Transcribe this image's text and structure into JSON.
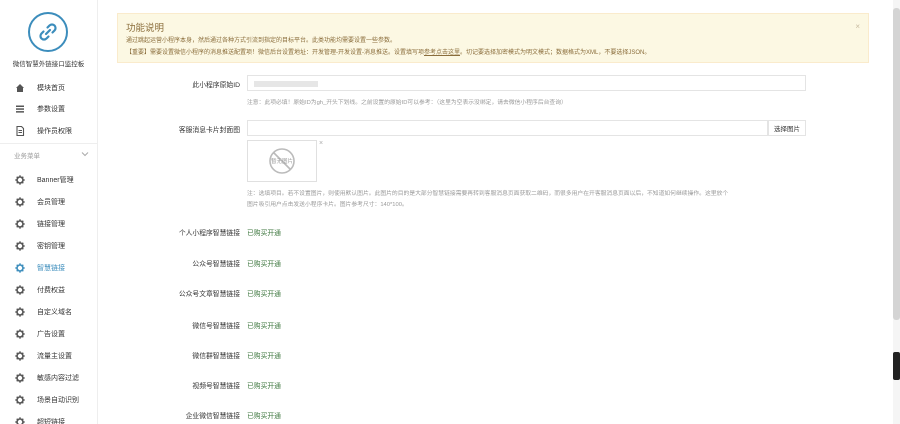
{
  "brand": {
    "name": "微信智慧外链接口监控板",
    "logo_icon": "link-icon",
    "accent": "#3c8dbc"
  },
  "sidebar": {
    "top_items": [
      {
        "label": "模块首页",
        "icon": "home-icon"
      },
      {
        "label": "参数设置",
        "icon": "list-icon"
      },
      {
        "label": "操作员权限",
        "icon": "file-icon"
      }
    ],
    "group_title": "业务菜单",
    "group_items": [
      {
        "label": "Banner管理",
        "icon": "gear-icon",
        "active": false
      },
      {
        "label": "会员管理",
        "icon": "gear-icon",
        "active": false
      },
      {
        "label": "链接管理",
        "icon": "gear-icon",
        "active": false
      },
      {
        "label": "密钥管理",
        "icon": "gear-icon",
        "active": false
      },
      {
        "label": "智慧链接",
        "icon": "gear-icon",
        "active": true
      },
      {
        "label": "付费权益",
        "icon": "gear-icon",
        "active": false
      },
      {
        "label": "自定义域名",
        "icon": "gear-icon",
        "active": false
      },
      {
        "label": "广告设置",
        "icon": "gear-icon",
        "active": false
      },
      {
        "label": "流量主设置",
        "icon": "gear-icon",
        "active": false
      },
      {
        "label": "敏感内容过滤",
        "icon": "gear-icon",
        "active": false
      },
      {
        "label": "场景自动识别",
        "icon": "gear-icon",
        "active": false
      },
      {
        "label": "超短链接",
        "icon": "gear-icon",
        "active": false
      }
    ]
  },
  "notice": {
    "title": "功能说明",
    "line1": "通过跳起运营小程序本身，然后通过各种方式引流到指定的目标平台。此类功能均需要设置一些参数。",
    "line2_prefix": "【重要】需要设置微信小程序的消息推送配置项！微信后台设置地址：开发管理-开发设置-消息推送。设置填写项",
    "line2_link": "参考点击这里",
    "line2_suffix": "。切记要选择加密模式为明文模式；数据格式为XML，不要选择JSON。",
    "close": "×"
  },
  "form": {
    "appid": {
      "label": "此小程序原始ID",
      "value": "",
      "help": "注意：此项必填！原始ID为gh_开头下划线。之前设置的原始ID可以参考：（这里为空表示没绑定，请去微信小程序后台查询）"
    },
    "cover": {
      "label": "客服消息卡片封面图",
      "value": "",
      "button": "选择图片",
      "thumb_text": "暂无图片",
      "remove": "×",
      "help_line1": "注：选填项目。若不设置图片，则使用默认图片。此图片的目的是大部分智慧链接需要再转到客服消息页面获取二维码，而很多用户在开客服消息页面以后，不知道如何继续操作。这里放个",
      "help_line2": "图片吸引用户点击发送小程序卡片。图片参考尺寸：140*100。"
    },
    "statuses": [
      {
        "label": "个人小程序智慧链接",
        "status": "已购买开通"
      },
      {
        "label": "公众号智慧链接",
        "status": "已购买开通"
      },
      {
        "label": "公众号文章智慧链接",
        "status": "已购买开通"
      },
      {
        "label": "微信号智慧链接",
        "status": "已购买开通"
      },
      {
        "label": "微信群智慧链接",
        "status": "已购买开通"
      },
      {
        "label": "视频号智慧链接",
        "status": "已购买开通"
      },
      {
        "label": "企业微信智慧链接",
        "status": "已购买开通"
      }
    ]
  }
}
